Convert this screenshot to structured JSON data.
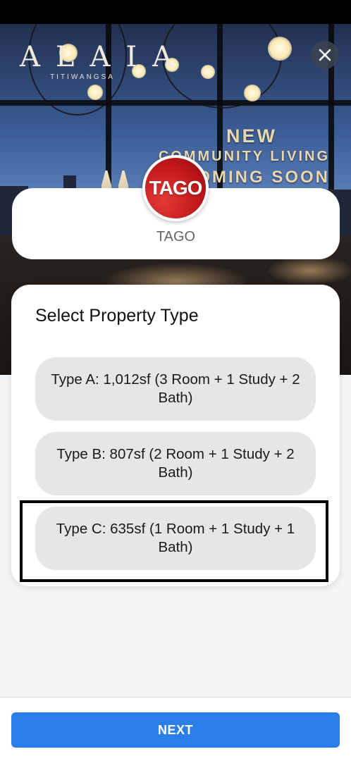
{
  "banner": {
    "brand_name": "ALAIA",
    "brand_sub": "TITIWANGSA",
    "promo_line1": "NEW",
    "promo_line2": "COMMUNITY LIVING",
    "promo_line3": "COMING SOON"
  },
  "developer": {
    "logo_text": "TAGO",
    "name": "TAGO"
  },
  "property_type": {
    "title": "Select Property Type",
    "options": [
      {
        "label": "Type A: 1,012sf (3 Room + 1 Study + 2 Bath)"
      },
      {
        "label": "Type B: 807sf (2 Room + 1 Study + 2 Bath)"
      },
      {
        "label": "Type C: 635sf (1 Room + 1 Study + 1 Bath)"
      }
    ],
    "highlighted_option": "Type C"
  },
  "footer": {
    "next_label": "NEXT"
  },
  "colors": {
    "primary": "#2b7de9",
    "option_bg": "#e6e6e6",
    "logo_red": "#c0171a"
  },
  "icons": {
    "close": "close-icon"
  }
}
